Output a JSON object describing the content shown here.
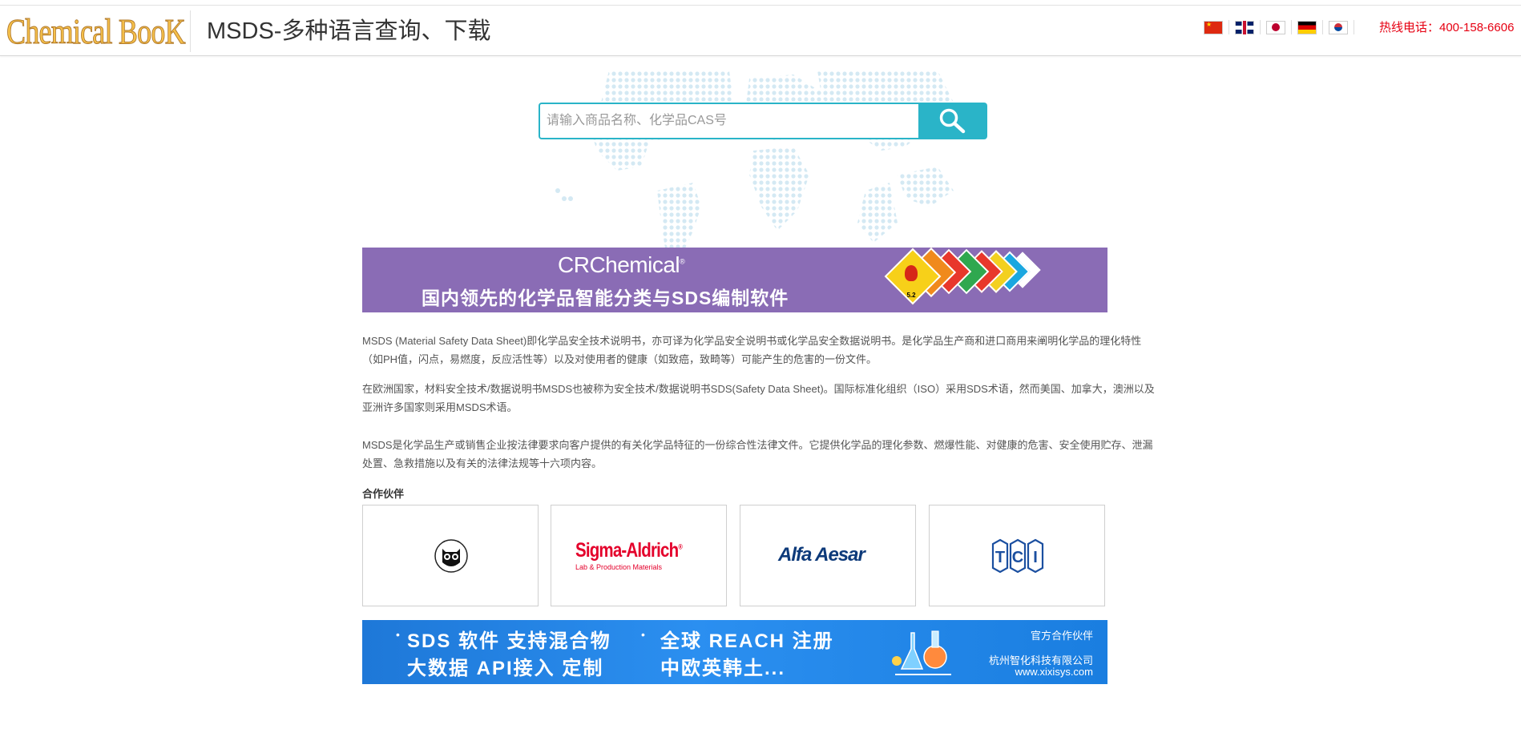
{
  "header": {
    "logo_text": "Chemical BooK",
    "title": "MSDS-多种语言查询、下载",
    "hotline": "热线电话：400-158-6606",
    "languages": [
      {
        "name": "中文",
        "icon": "china-flag-icon"
      },
      {
        "name": "English",
        "icon": "uk-flag-icon"
      },
      {
        "name": "日本語",
        "icon": "japan-flag-icon"
      },
      {
        "name": "Deutsch",
        "icon": "germany-flag-icon"
      },
      {
        "name": "한국어",
        "icon": "korea-flag-icon"
      }
    ]
  },
  "search": {
    "placeholder": "请输入商品名称、化学品CAS号",
    "value": "",
    "button_icon": "search-icon"
  },
  "banner_top": {
    "brand": "CRChemical",
    "reg_mark": "®",
    "slogan": "国内领先的化学品智能分类与SDS编制软件",
    "hazard_label": "5.2"
  },
  "intro": {
    "p1": "MSDS (Material Safety Data Sheet)即化学品安全技术说明书，亦可译为化学品安全说明书或化学品安全数据说明书。是化学品生产商和进口商用来阐明化学品的理化特性（如PH值，闪点，易燃度，反应活性等）以及对使用者的健康（如致癌，致畸等）可能产生的危害的一份文件。",
    "p2": "在欧洲国家，材料安全技术/数据说明书MSDS也被称为安全技术/数据说明书SDS(Safety Data Sheet)。国际标准化组织（ISO）采用SDS术语，然而美国、加拿大，澳洲以及亚洲许多国家则采用MSDS术语。",
    "p3": "MSDS是化学品生产或销售企业按法律要求向客户提供的有关化学品特征的一份综合性法律文件。它提供化学品的理化参数、燃爆性能、对健康的危害、安全使用贮存、泄漏处置、急救措施以及有关的法律法规等十六项内容。"
  },
  "partners": {
    "title": "合作伙伴",
    "items": [
      {
        "name": "owl-logo"
      },
      {
        "name": "Sigma-Aldrich",
        "label": "Sigma-Aldrich",
        "sub": "Lab & Production Materials",
        "reg": "®"
      },
      {
        "name": "Alfa Aesar",
        "label": "Alfa Aesar"
      },
      {
        "name": "TCI",
        "label": "TCI"
      }
    ]
  },
  "banner_bottom": {
    "line1a": "SDS 软件 支持混合物",
    "line1b": "全球 REACH 注册",
    "line2a": "大数据 API接入 定制",
    "line2b": "中欧英韩土...",
    "partner_label": "官方合作伙伴",
    "company": "杭州智化科技有限公司",
    "url": "www.xixisys.com"
  },
  "colors": {
    "accent": "#2ab4c8",
    "hotline": "#e60012",
    "banner_purple": "#8a6cb5",
    "banner_blue": "#2b8ff0"
  }
}
